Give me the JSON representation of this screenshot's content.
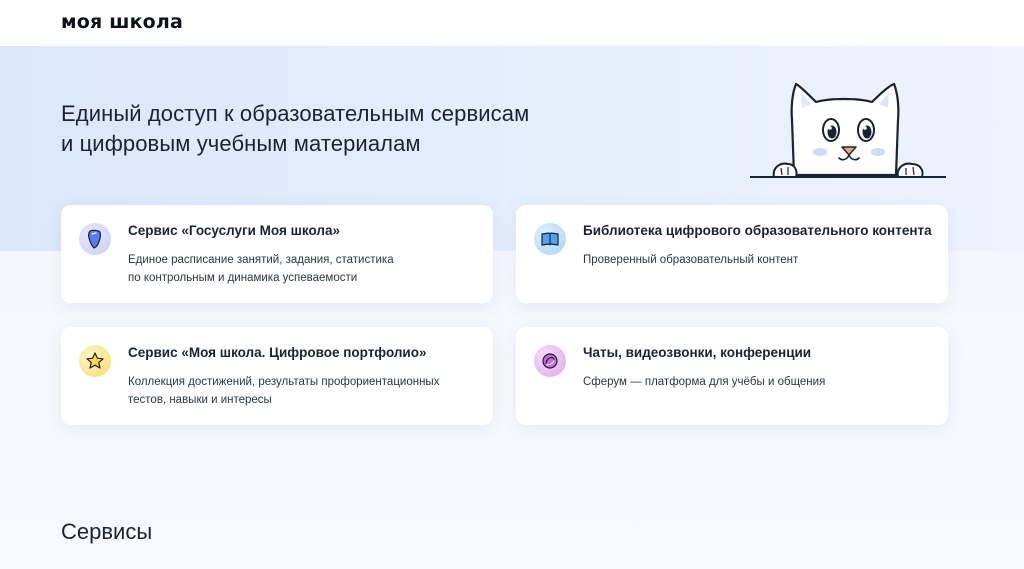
{
  "header": {
    "logo_text": "моя школа"
  },
  "hero": {
    "title_line1": "Единый доступ к образовательным сервисам",
    "title_line2": "и цифровым учебным материалам",
    "illustration": "cat-mascot"
  },
  "cards": [
    {
      "icon": "gosuslugi-shield-icon",
      "title": "Сервис «Госуслуги Моя школа»",
      "desc_line1": "Единое расписание занятий, задания, статистика",
      "desc_line2": "по контрольным и динамика успеваемости"
    },
    {
      "icon": "book-icon",
      "title": "Библиотека цифрового образовательного контента",
      "desc_line1": "Проверенный образовательный контент",
      "desc_line2": ""
    },
    {
      "icon": "star-icon",
      "title": "Сервис «Моя школа. Цифровое портфолио»",
      "desc_line1": "Коллекция достижений, результаты профориентационных",
      "desc_line2": "тестов, навыки и интересы"
    },
    {
      "icon": "sferum-icon",
      "title": "Чаты, видеозвонки, конференции",
      "desc_line1": "Сферум — платформа для учёбы и общения",
      "desc_line2": ""
    }
  ],
  "services": {
    "title": "Сервисы"
  },
  "colors": {
    "hero_bg": "#dbe7fb",
    "text": "#1b2233",
    "card_bg": "#ffffff"
  }
}
